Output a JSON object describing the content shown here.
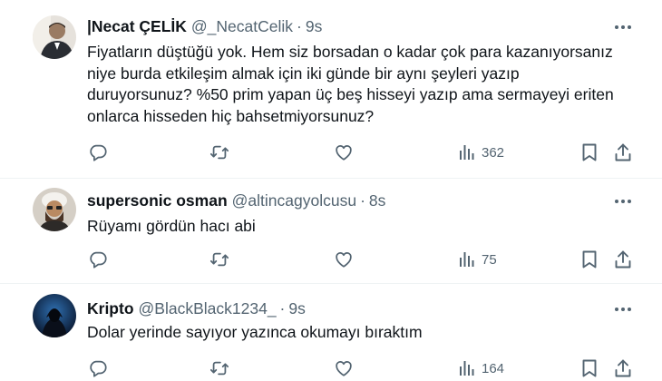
{
  "icons": {
    "more": "more-horizontal-icon",
    "reply": "reply-icon",
    "retweet": "retweet-icon",
    "like": "like-icon",
    "views": "views-icon",
    "bookmark": "bookmark-icon",
    "share": "share-icon"
  },
  "colors": {
    "text": "#0f1419",
    "secondary": "#536471",
    "divider": "#eff3f4"
  },
  "tweets": [
    {
      "name": "|Necat ÇELİK",
      "handle": "@_NecatCelik",
      "sep": "·",
      "time": "9s",
      "lines": [
        "Fiyatların düştüğü yok. Hem siz borsadan o kadar çok para kazanıyorsanız",
        "niye burda etkileşim almak için iki günde bir aynı şeyleri yazıp",
        "duruyorsunuz? %50 prim yapan üç beş hisseyi yazıp ama sermayeyi eriten",
        "onlarca hisseden hiç bahsetmiyorsunuz?"
      ],
      "views": "362"
    },
    {
      "name": "supersonic osman",
      "handle": "@altincagyolcusu",
      "sep": "·",
      "time": "8s",
      "lines": [
        "Rüyamı gördün hacı abi"
      ],
      "views": "75"
    },
    {
      "name": "Kripto",
      "handle": "@BlackBlack1234_",
      "sep": "·",
      "time": "9s",
      "lines": [
        "Dolar yerinde sayıyor yazınca okumayı bıraktım"
      ],
      "views": "164"
    }
  ]
}
